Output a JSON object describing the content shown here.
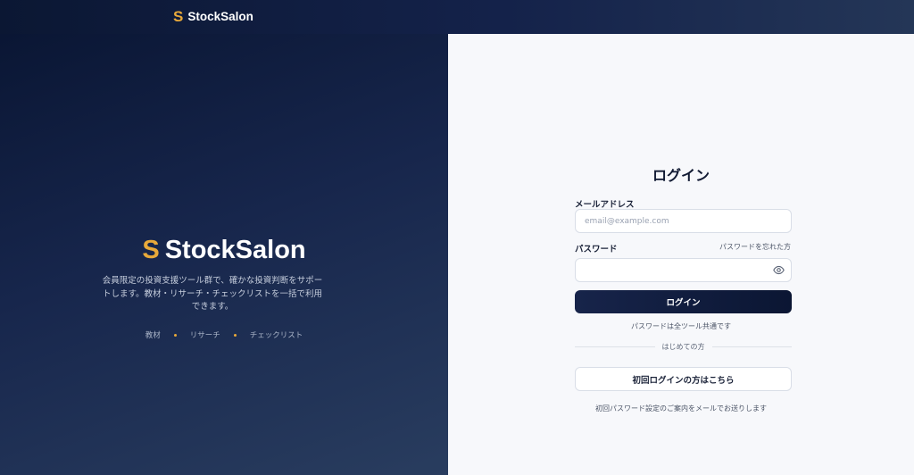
{
  "header": {
    "logo_mark": "S",
    "brand": "StockSalon"
  },
  "hero": {
    "logo_mark": "S",
    "brand": "StockSalon",
    "description": "会員限定の投資支援ツール群で、確かな投資判断をサポートします。教材・リサーチ・チェックリストを一括で利用できます。",
    "tags": [
      "教材",
      "リサーチ",
      "チェックリスト"
    ]
  },
  "login": {
    "title": "ログイン",
    "email_label": "メールアドレス",
    "email_placeholder": "email@example.com",
    "email_value": "",
    "password_label": "パスワード",
    "password_value": "",
    "forgot_link": "パスワードを忘れた方",
    "submit_label": "ログイン",
    "password_note": "パスワードは全ツール共通です",
    "divider_text": "はじめての方",
    "first_login_label": "初回ログインの方はこちら",
    "first_login_note": "初回パスワード設定のご案内をメールでお送りします"
  },
  "colors": {
    "accent": "#e8a93a",
    "navy": "#0b1733",
    "panel_bg": "#f7f8fb"
  },
  "icons": {
    "password_toggle": "eye-icon"
  }
}
